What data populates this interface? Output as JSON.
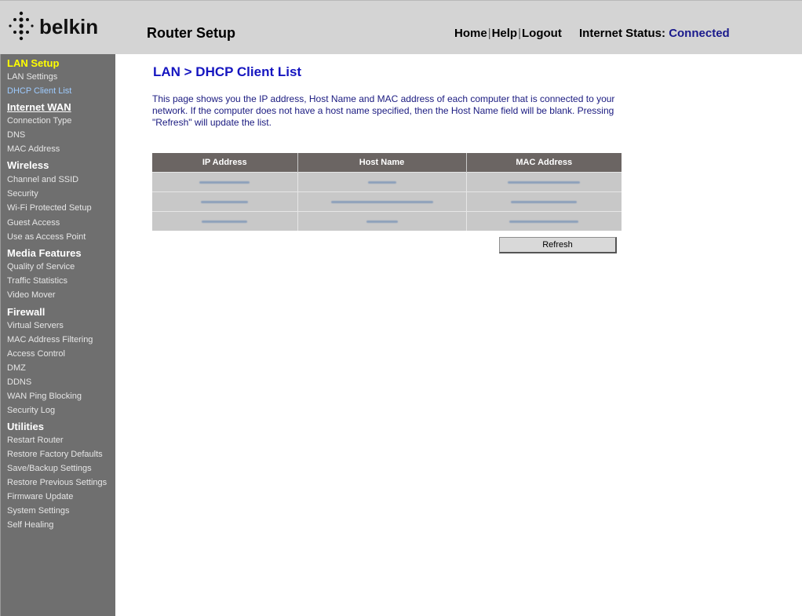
{
  "header": {
    "brand": "belkin",
    "title": "Router Setup",
    "links": [
      "Home",
      "Help",
      "Logout"
    ],
    "status_label": "Internet Status:",
    "status_value": "Connected"
  },
  "sidebar": {
    "sections": [
      {
        "heading": "LAN Setup",
        "items": [
          "LAN Settings",
          "DHCP Client List"
        ]
      },
      {
        "heading": "Internet WAN",
        "items": [
          "Connection Type",
          "DNS",
          "MAC Address"
        ]
      },
      {
        "heading": "Wireless",
        "items": [
          "Channel and SSID",
          "Security",
          "Wi-Fi Protected Setup",
          "Guest Access",
          "Use as Access Point"
        ]
      },
      {
        "heading": "Media Features",
        "items": [
          "Quality of Service",
          "Traffic Statistics",
          "Video Mover"
        ]
      },
      {
        "heading": "Firewall",
        "items": [
          "Virtual Servers",
          "MAC Address Filtering",
          "Access Control",
          "DMZ",
          "DDNS",
          "WAN Ping Blocking",
          "Security Log"
        ]
      },
      {
        "heading": "Utilities",
        "items": [
          "Restart Router",
          "Restore Factory Defaults",
          "Save/Backup Settings",
          "Restore Previous Settings",
          "Firmware Update",
          "System Settings",
          "Self Healing"
        ]
      }
    ]
  },
  "main": {
    "heading": "LAN > DHCP Client List",
    "intro": "This page shows you the IP address, Host Name and MAC address of each computer that is connected to your network. If the computer does not have a host name specified, then the Host Name field will be blank. Pressing \"Refresh\" will update the list.",
    "table": {
      "columns": [
        "IP Address",
        "Host Name",
        "MAC Address"
      ]
    },
    "refresh_label": "Refresh"
  }
}
